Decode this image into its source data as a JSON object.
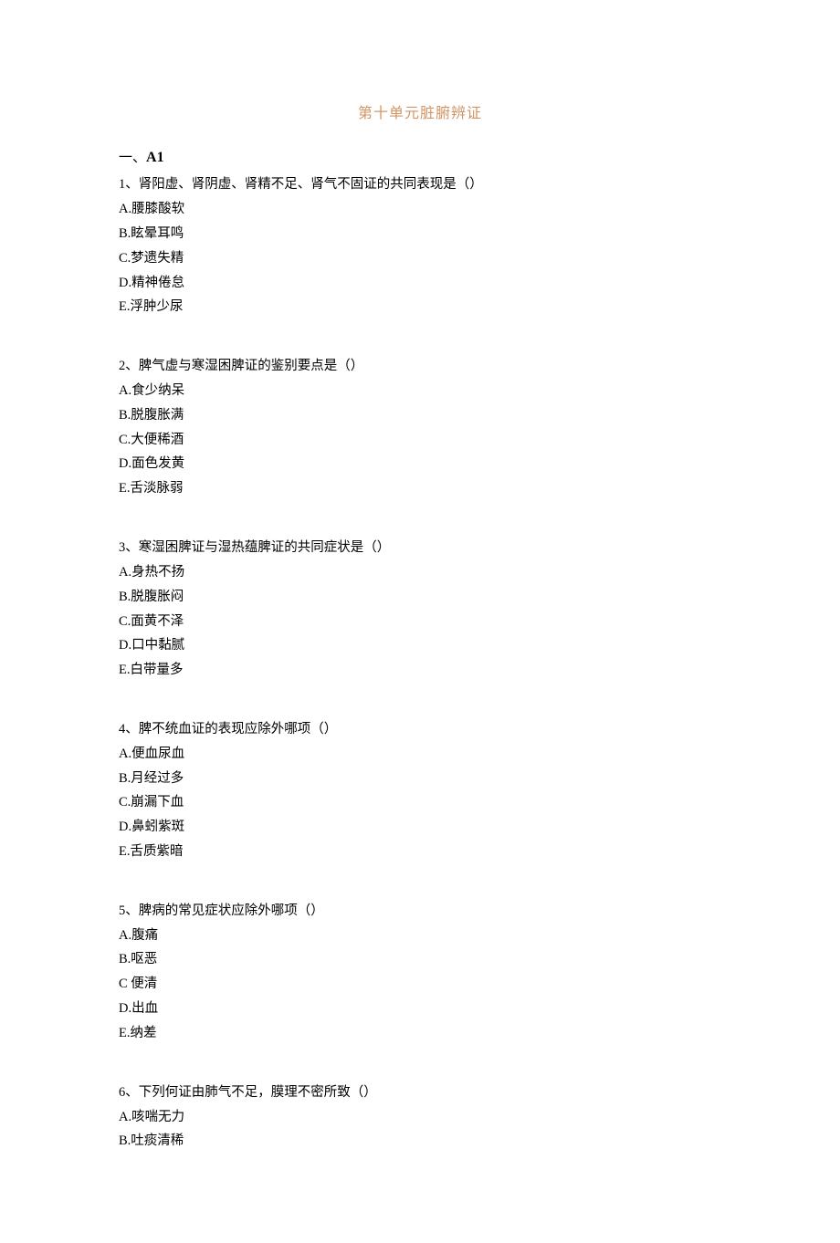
{
  "title": "第十单元脏腑辨证",
  "section": {
    "prefix": "一、",
    "label": "A1"
  },
  "questions": [
    {
      "num": "1、",
      "text": "肾阳虚、肾阴虚、肾精不足、肾气不固证的共同表现是（）",
      "options": [
        "A.腰膝酸软",
        "B.眩晕耳鸣",
        "C.梦遗失精",
        "D.精神倦怠",
        "E.浮肿少尿"
      ]
    },
    {
      "num": "2、",
      "text": "脾气虚与寒湿困脾证的鉴别要点是（）",
      "options": [
        "A.食少纳呆",
        "B.脱腹胀满",
        "C.大便稀酒",
        "D.面色发黄",
        "E.舌淡脉弱"
      ]
    },
    {
      "num": "3、",
      "text": "寒湿困脾证与湿热蕴脾证的共同症状是（）",
      "options": [
        "A.身热不扬",
        "B.脱腹胀闷",
        "C.面黄不泽",
        "D.口中黏腻",
        "E.白带量多"
      ]
    },
    {
      "num": "4、",
      "text": "脾不统血证的表现应除外哪项（）",
      "options": [
        "A.便血尿血",
        "B.月经过多",
        "C.崩漏下血",
        "D.鼻蚓紫斑",
        "E.舌质紫暗"
      ]
    },
    {
      "num": "5、",
      "text": "脾病的常见症状应除外哪项（）",
      "options": [
        "A.腹痛",
        "B.呕恶",
        "C 便清",
        "D.出血",
        "E.纳差"
      ]
    },
    {
      "num": "6、",
      "text": "下列何证由肺气不足，膜理不密所致（）",
      "options": [
        "A.咳喘无力",
        "B.吐痰清稀"
      ]
    }
  ]
}
